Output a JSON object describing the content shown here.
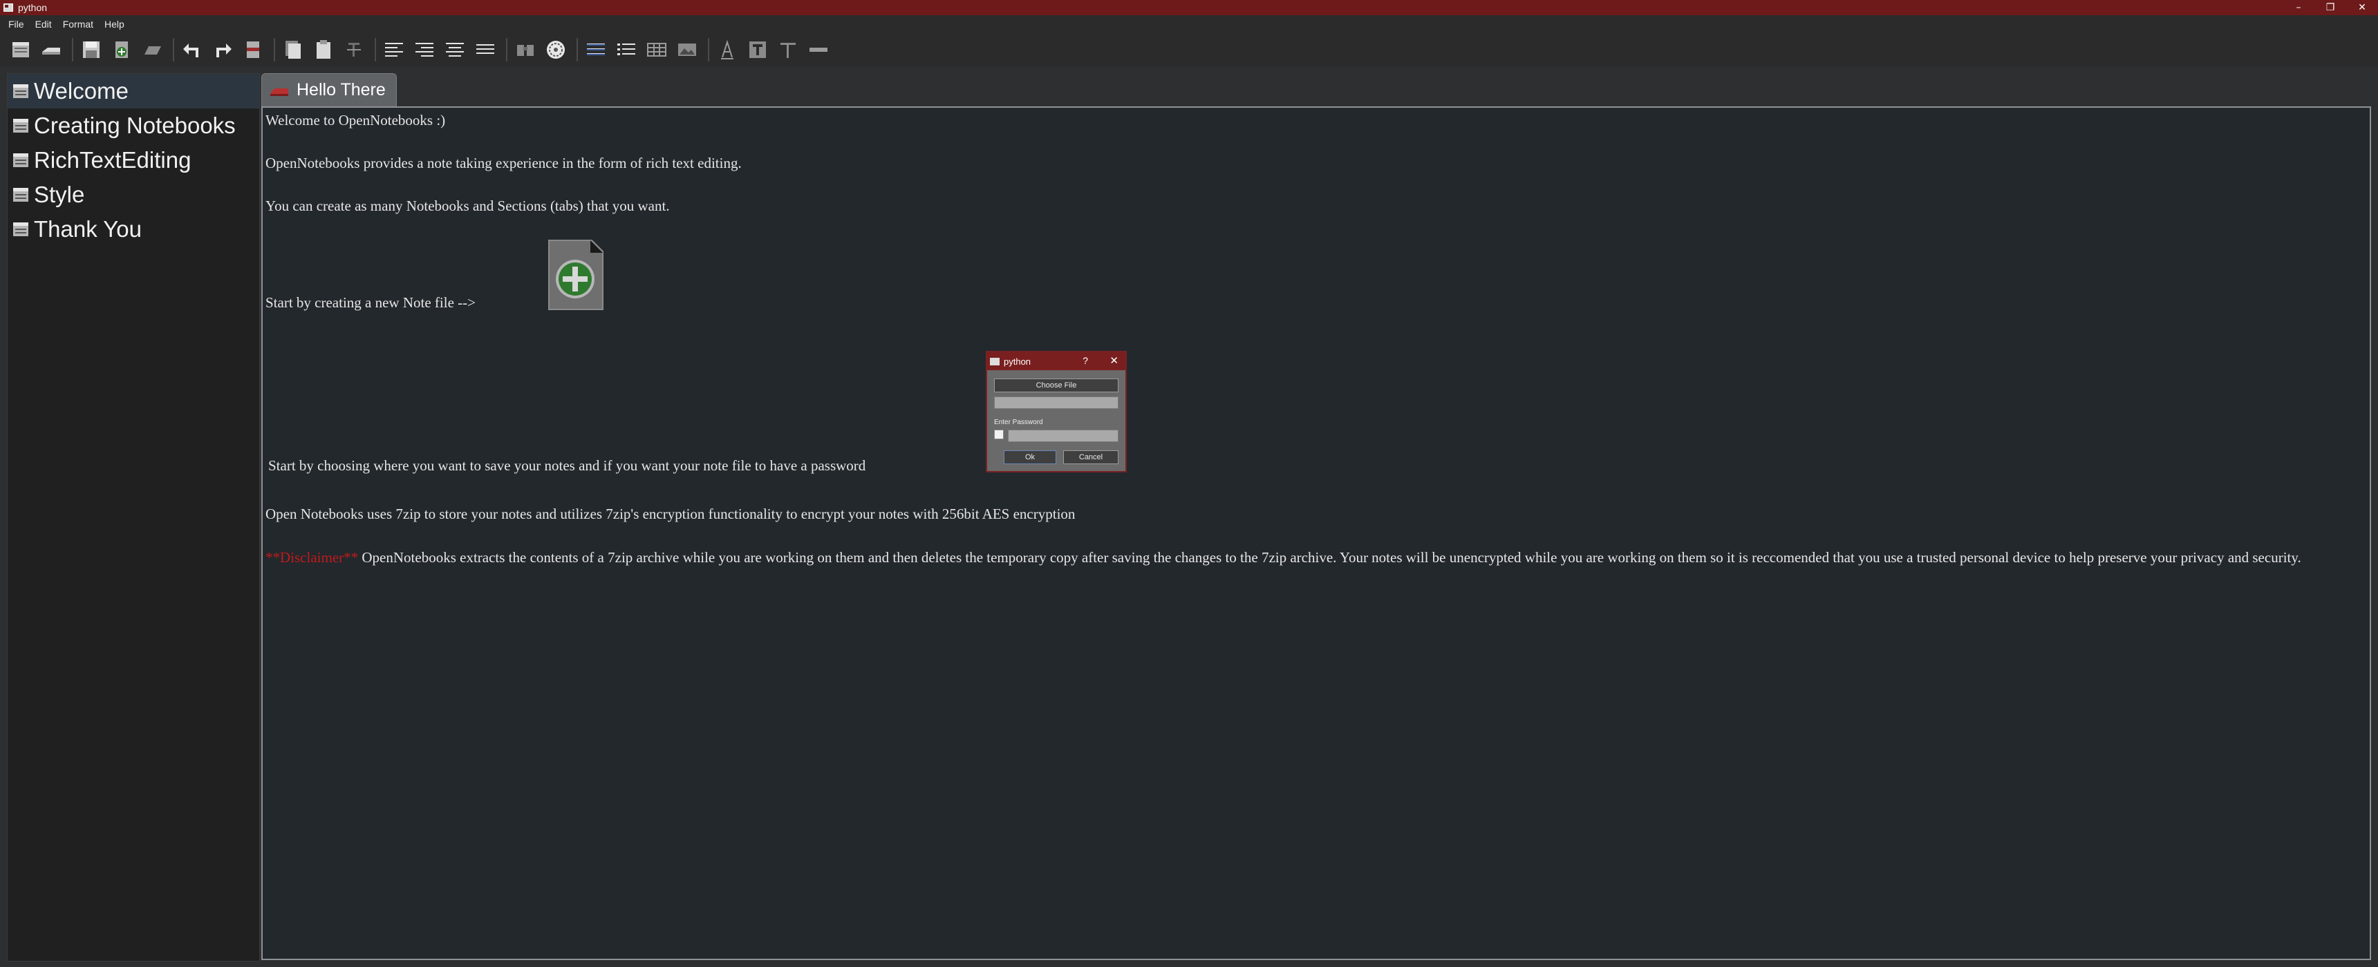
{
  "window": {
    "title": "python",
    "controls": {
      "minimize": "–",
      "restore": "❐",
      "close": "✕"
    }
  },
  "menu": [
    "File",
    "Edit",
    "Format",
    "Help"
  ],
  "toolbar": {
    "buttons": [
      "new-notebook-icon",
      "remove-notebook-icon",
      "save-icon",
      "add-section-icon",
      "remove-section-icon",
      "undo-icon",
      "redo-icon",
      "cut-icon",
      "copy-icon",
      "paste-icon",
      "strikethrough-icon",
      "align-left-icon",
      "align-right-icon",
      "align-center-icon",
      "justify-icon",
      "binoculars-icon",
      "color-wheel-icon",
      "bullet-list-icon",
      "numbered-list-icon",
      "table-icon",
      "image-icon",
      "font-color-icon",
      "text-background-icon",
      "font-size-icon",
      "horizontal-rule-icon"
    ]
  },
  "sidebar": {
    "items": [
      {
        "label": "Welcome",
        "selected": true
      },
      {
        "label": "Creating Notebooks"
      },
      {
        "label": "RichTextEditing"
      },
      {
        "label": "Style"
      },
      {
        "label": "Thank You"
      }
    ]
  },
  "tab": {
    "label": "Hello There"
  },
  "editor": {
    "line1": "Welcome to OpenNotebooks :)",
    "line2": "OpenNotebooks provides a note taking experience in the form of rich text editing.",
    "line3": "You can create as many Notebooks and Sections (tabs) that you want.",
    "line4": "Start by creating a new Note file -->",
    "line5": "Start by choosing where you want to save your notes and if you want your note file to have a password",
    "line6": "Open Notebooks uses 7zip to store your notes and utilizes 7zip's encryption functionality to encrypt your notes with 256bit AES encryption",
    "disclaimer_label": "**Disclaimer**",
    "disclaimer_text": " OpenNotebooks extracts the contents of a 7zip archive while you are working on them and then deletes the temporary copy after saving the changes to the 7zip archive. Your notes will be unencrypted while you are working on them so it is reccomended that you use a trusted personal device to help preserve your privacy and security."
  },
  "dialog": {
    "title": "python",
    "help": "?",
    "close": "✕",
    "choose_file": "Choose File",
    "password_label": "Enter Password",
    "ok": "Ok",
    "cancel": "Cancel"
  },
  "colors": {
    "titlebar": "#6e1a1a",
    "editor_bg": "#23282d",
    "disclaimer": "#c01a1a",
    "selected_item": "#2c3640"
  }
}
